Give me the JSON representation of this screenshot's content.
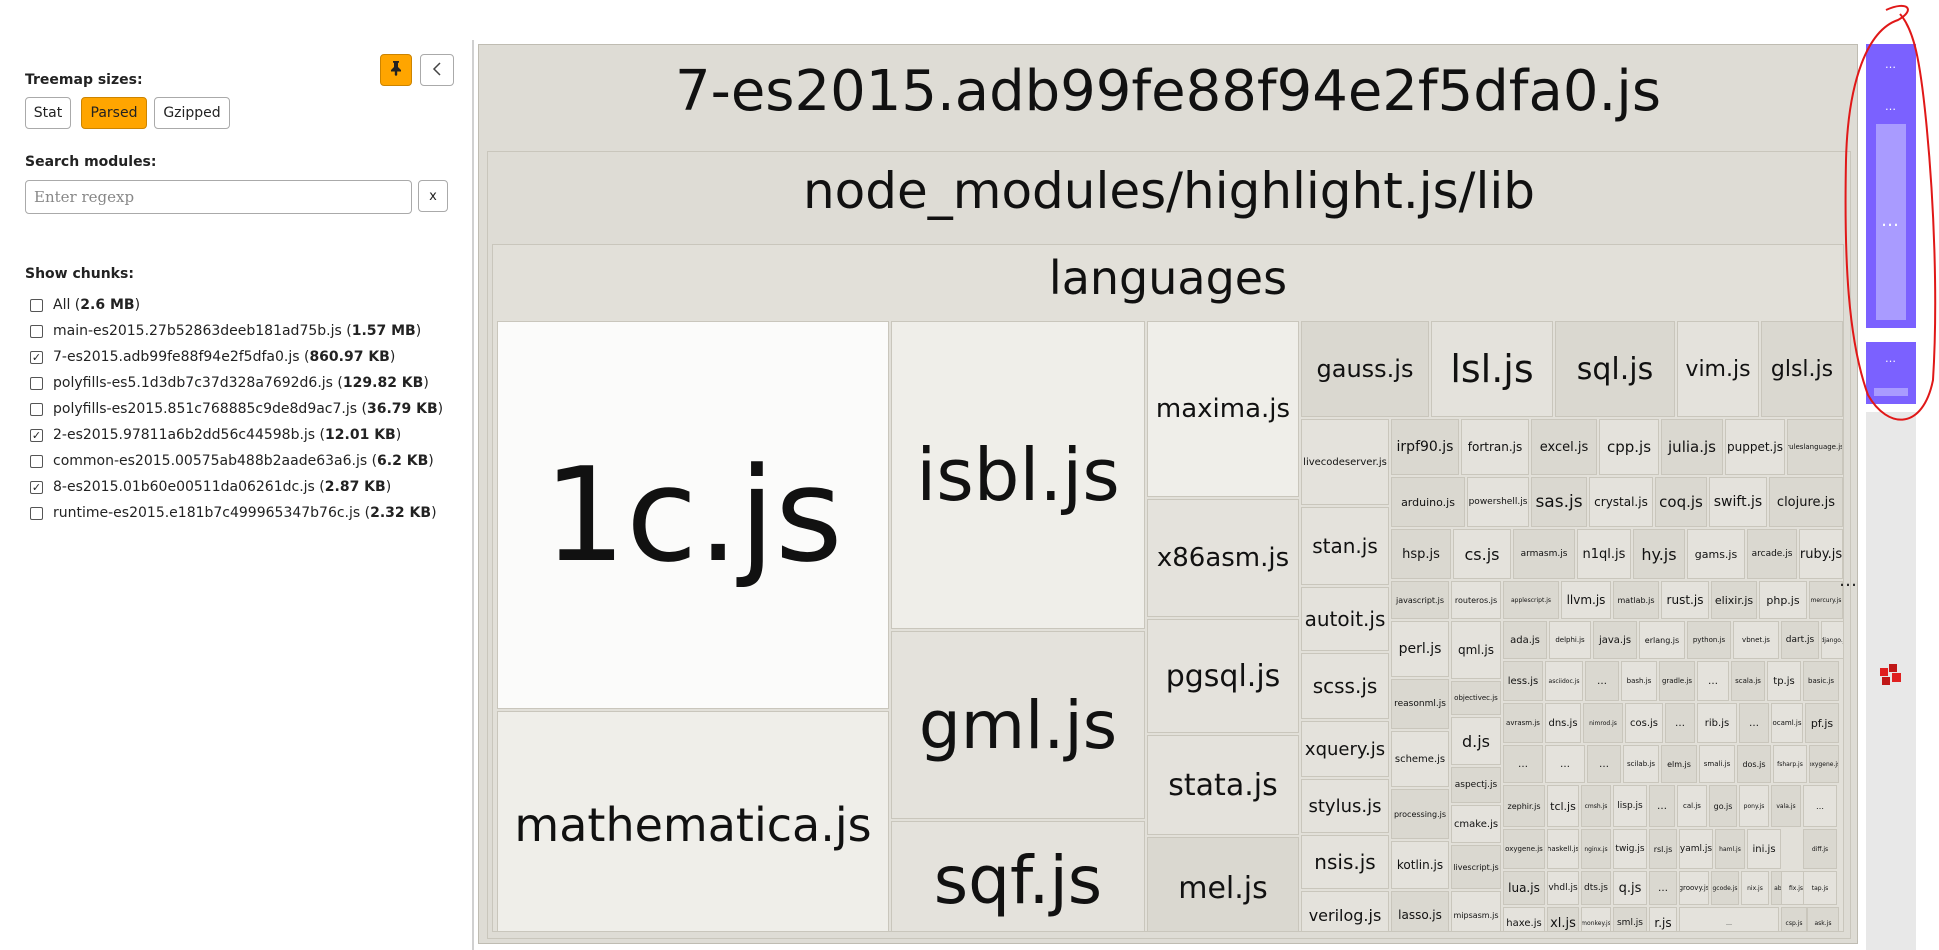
{
  "sidebar": {
    "treemap_sizes_label": "Treemap sizes:",
    "size_options": [
      {
        "label": "Stat",
        "active": false
      },
      {
        "label": "Parsed",
        "active": true
      },
      {
        "label": "Gzipped",
        "active": false
      }
    ],
    "search_label": "Search modules:",
    "search_placeholder": "Enter regexp",
    "search_value": "",
    "clear_label": "x",
    "show_chunks_label": "Show chunks:",
    "chunks": [
      {
        "name": "All",
        "size": "2.6 MB",
        "checked": false
      },
      {
        "name": "main-es2015.27b52863deeb181ad75b.js",
        "size": "1.57 MB",
        "checked": false
      },
      {
        "name": "7-es2015.adb99fe88f94e2f5dfa0.js",
        "size": "860.97 KB",
        "checked": true
      },
      {
        "name": "polyfills-es5.1d3db7c37d328a7692d6.js",
        "size": "129.82 KB",
        "checked": false
      },
      {
        "name": "polyfills-es2015.851c768885c9de8d9ac7.js",
        "size": "36.79 KB",
        "checked": false
      },
      {
        "name": "2-es2015.97811a6b2dd56c44598b.js",
        "size": "12.01 KB",
        "checked": true
      },
      {
        "name": "common-es2015.00575ab488b2aade63a6.js",
        "size": "6.2 KB",
        "checked": false
      },
      {
        "name": "8-es2015.01b60e00511da06261dc.js",
        "size": "2.87 KB",
        "checked": true
      },
      {
        "name": "runtime-es2015.e181b7c499965347b76c.js",
        "size": "2.32 KB",
        "checked": false
      }
    ]
  },
  "treemap": {
    "chunk_title": "7-es2015.adb99fe88f94e2f5dfa0.js",
    "folder_title": "node_modules/highlight.js/lib",
    "subfolder_title": "languages",
    "big_tiles": [
      "1c.js",
      "mathematica.js",
      "isbl.js",
      "gml.js",
      "sqf.js",
      "maxima.js",
      "x86asm.js",
      "pgsql.js",
      "stata.js",
      "mel.js"
    ],
    "top_row": [
      "gauss.js",
      "lsl.js",
      "sql.js",
      "vim.js",
      "glsl.js"
    ],
    "col_left": [
      "livecodeserver.js",
      "stan.js",
      "autoit.js",
      "scss.js",
      "xquery.js",
      "stylus.js",
      "nsis.js",
      "verilog.js"
    ],
    "small_row1": [
      "irpf90.js",
      "fortran.js",
      "excel.js",
      "cpp.js",
      "julia.js",
      "puppet.js",
      "ruleslanguage.js"
    ],
    "small_row2": [
      "arduino.js",
      "powershell.js",
      "sas.js",
      "crystal.js",
      "coq.js",
      "swift.js",
      "clojure.js"
    ],
    "small_row3": [
      "hsp.js",
      "cs.js",
      "armasm.js",
      "n1ql.js",
      "hy.js",
      "gams.js",
      "arcade.js",
      "ruby.js"
    ],
    "small_row4": [
      "javascript.js",
      "routeros.js",
      "applescript.js",
      "llvm.js",
      "matlab.js",
      "rust.js",
      "elixir.js",
      "php.js",
      "mercury.js"
    ],
    "col_mid": [
      "perl.js",
      "reasonml.js",
      "scheme.js",
      "processing.js",
      "kotlin.js",
      "lasso.js"
    ],
    "col_mid2": [
      "qml.js",
      "objectivec.js",
      "d.js",
      "aspectj.js",
      "cmake.js",
      "livescript.js",
      "mipsasm.js"
    ],
    "small_row5": [
      "ada.js",
      "delphi.js",
      "java.js",
      "erlang.js",
      "python.js",
      "vbnet.js",
      "dart.js",
      "django.js"
    ],
    "small_row6": [
      "less.js",
      "asciidoc.js",
      "…",
      "bash.js",
      "gradle.js",
      "…",
      "scala.js",
      "tp.js",
      "basic.js"
    ],
    "small_row7": [
      "avrasm.js",
      "dns.js",
      "nimrod.js",
      "cos.js",
      "…",
      "rib.js",
      "…",
      "ocaml.js",
      "pf.js"
    ],
    "small_row8": [
      "…",
      "…",
      "…",
      "scilab.js",
      "elm.js",
      "smali.js",
      "dos.js",
      "fsharp.js",
      "oxygene.js"
    ],
    "tiny_tiles": [
      "zephir.js",
      "tcl.js",
      "cmsh.js",
      "lisp.js",
      "…",
      "cal.js",
      "go.js",
      "pony.js",
      "vala.js",
      "…",
      "oxygene.js",
      "haskell.js",
      "nginx.js",
      "twig.js",
      "rsl.js",
      "yaml.js",
      "haml.js",
      "ini.js",
      "lua.js",
      "vhdl.js",
      "dts.js",
      "q.js",
      "…",
      "groovy.js",
      "gcode.js",
      "nix.js",
      "abnf.js",
      "haxe.js",
      "xl.js",
      "monkey.js",
      "sml.js",
      "r.js",
      "diff.js",
      "fix.js",
      "ask.js",
      "tap.js",
      "csp.js"
    ],
    "overflow_marker": "…"
  },
  "right_panel": {
    "dots": "…",
    "accent_color": "#7b61ff"
  }
}
